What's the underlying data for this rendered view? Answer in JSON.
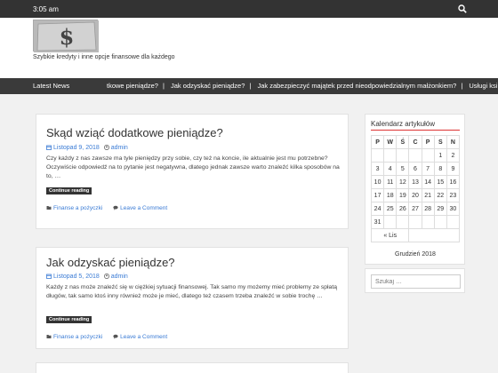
{
  "topbar": {
    "time": "3:05 am"
  },
  "site": {
    "tagline": "Szybkie kredyty i inne opcje finansowe dla każdego",
    "logo_symbol": "$"
  },
  "newsbar": {
    "label": "Latest News",
    "items": [
      "tkowe pieniądze?",
      "Jak odzyskać pieniądze?",
      "Jak zabezpieczyć majątek przed nieodpowiedzialnym małżonkiem?",
      "Usługi ksi"
    ]
  },
  "articles": [
    {
      "title": "Skąd wziąć dodatkowe pieniądze?",
      "date": "Listopad 9, 2018",
      "author": "admin",
      "excerpt": "Czy każdy z nas zawsze ma tyle pieniędzy przy sobie, czy też na koncie, ile aktualnie jest mu potrzebne? Oczywiście odpowiedź na to pytanie jest negatywna, dlatego jednak zawsze warto znaleźć kilka sposobów na to, …",
      "readmore": "Continue reading",
      "category": "Finanse a pożyczki",
      "comment": "Leave a Comment"
    },
    {
      "title": "Jak odzyskać pieniądze?",
      "date": "Listopad 5, 2018",
      "author": "admin",
      "excerpt": "Każdy z nas może znaleźć się w ciężkiej sytuacji finansowej. Tak samo my możemy mieć problemy ze spłatą długów, tak samo ktoś inny również może je mieć, dlatego też czasem trzeba znaleźć w sobie trochę …",
      "readmore": "Continue reading",
      "category": "Finanse a pożyczki",
      "comment": "Leave a Comment"
    }
  ],
  "calendar": {
    "title": "Kalendarz artykułów",
    "weekdays": [
      "P",
      "W",
      "Ś",
      "C",
      "P",
      "S",
      "N"
    ],
    "rows": [
      [
        "",
        "",
        "",
        "",
        "",
        "1",
        "2"
      ],
      [
        "3",
        "4",
        "5",
        "6",
        "7",
        "8",
        "9"
      ],
      [
        "10",
        "11",
        "12",
        "13",
        "14",
        "15",
        "16"
      ],
      [
        "17",
        "18",
        "19",
        "20",
        "21",
        "22",
        "23"
      ],
      [
        "24",
        "25",
        "26",
        "27",
        "28",
        "29",
        "30"
      ],
      [
        "31",
        "",
        "",
        "",
        "",
        "",
        ""
      ]
    ],
    "prev": "« Lis",
    "month": "Grudzień 2018"
  },
  "search": {
    "placeholder": "Szukaj …"
  },
  "colors": {
    "topbar": "#333333",
    "newsbar": "#3a3a3a",
    "link": "#3a7bd5",
    "accent": "#dd3333"
  }
}
